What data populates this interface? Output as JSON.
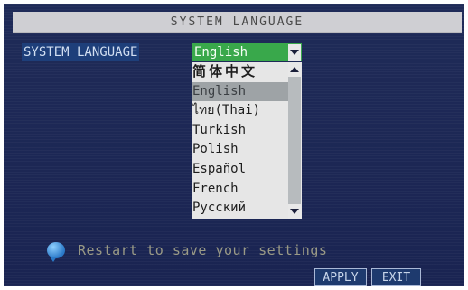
{
  "window": {
    "title": "SYSTEM LANGUAGE"
  },
  "setting": {
    "label": "SYSTEM LANGUAGE"
  },
  "dropdown": {
    "selected": "English",
    "options": [
      "简体中文",
      "English",
      "ไทย(Thai)",
      "Turkish",
      "Polish",
      "Español",
      "French",
      "Русский"
    ],
    "highlighted_index": 1
  },
  "message": {
    "text": "Restart to save your settings",
    "icon": "info-bubble-icon"
  },
  "buttons": {
    "apply": "APPLY",
    "exit": "EXIT"
  },
  "colors": {
    "background": "#1f2a55",
    "titlebar": "#cfcfd3",
    "dropdown_selected": "#39a84b",
    "list_background": "#e6e6e6",
    "list_highlight": "#9ea3a6"
  }
}
